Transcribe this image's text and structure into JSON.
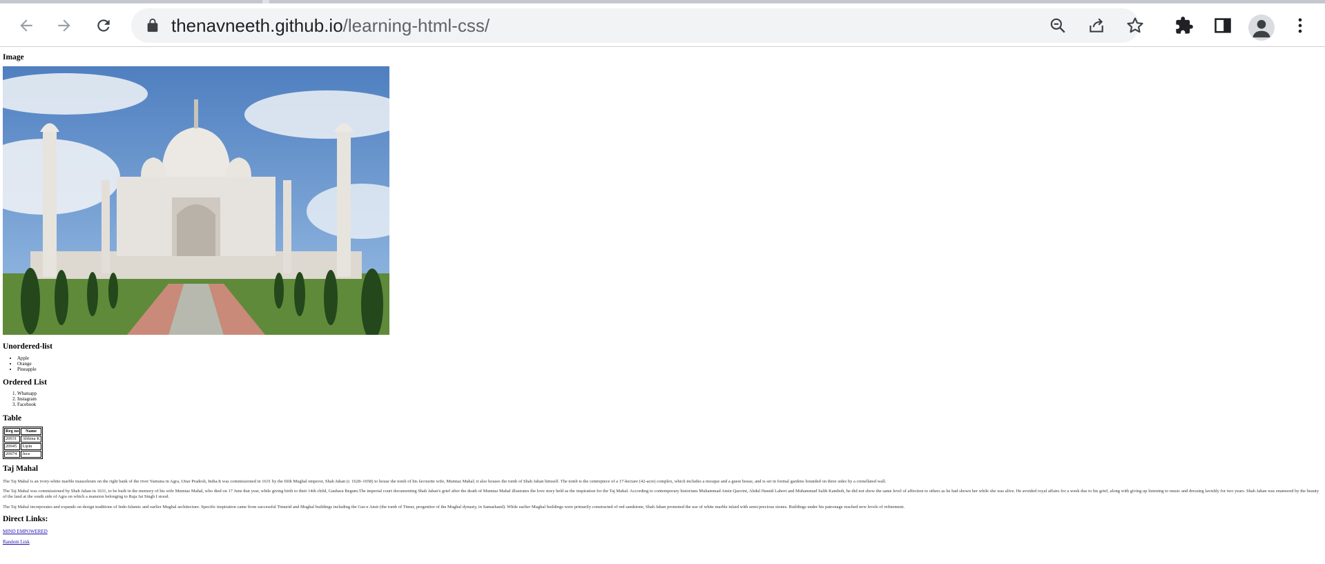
{
  "browser": {
    "url_host": "thenavneeth.github.io",
    "url_path": "/learning-html-css/",
    "icons": [
      "back-icon",
      "forward-icon",
      "reload-icon",
      "lock-icon",
      "zoom-out-icon",
      "share-icon",
      "star-icon",
      "extensions-icon",
      "side-panel-icon",
      "profile-icon",
      "menu-icon"
    ]
  },
  "page": {
    "image_heading": "Image",
    "unordered_heading": "Unordered-list",
    "unordered_items": [
      "Apple",
      "Orange",
      "Pineapple"
    ],
    "ordered_heading": "Ordered List",
    "ordered_items": [
      "Whatsapp",
      "Instagram",
      "Facebook"
    ],
    "table_heading": "Table",
    "table": {
      "headers": [
        "Reg no",
        "Name"
      ],
      "rows": [
        [
          "20031",
          "Abhina K"
        ],
        [
          "20045",
          "Lipin"
        ],
        [
          "20074",
          "Jece"
        ]
      ]
    },
    "taj_heading": "Taj Mahal",
    "paragraphs": [
      "The Taj Mahal is an ivory-white marble mausoleum on the right bank of the river Yamuna in Agra, Uttar Pradesh, India.It was commissioned in 1631 by the fifth Mughal emperor, Shah Jahan (r. 1628–1658) to house the tomb of his favourite wife, Mumtaz Mahal; it also houses the tomb of Shah Jahan himself. The tomb is the centrepiece of a 17-hectare (42-acre) complex, which includes a mosque and a guest house, and is set in formal gardens bounded on three sides by a crenellated wall.",
      "The Taj Mahal was commissioned by Shah Jahan in 1631, to be built in the memory of his wife Mumtaz Mahal, who died on 17 June that year, while giving birth to their 14th child, Gauhara Begum.The imperial court documenting Shah Jahan's grief after the death of Mumtaz Mahal illustrates the love story held as the inspiration for the Taj Mahal. According to contemporary historians Muhammad Amin Qazvini, Abdul Hamid Lahori and Muhammad Salih Kamboh, he did not show the same level of affection to others as he had shown her while she was alive. He avoided royal affairs for a week due to his grief, along with giving up listening to music and dressing lavishly for two years. Shah Jahan was enamored by the beauty of the land at the south side of Agra on which a mansion belonging to Raja Jai Singh I stood.",
      "The Taj Mahal incorporates and expands on design traditions of Indo-Islamic and earlier Mughal architecture. Specific inspiration came from successful Timurid and Mughal buildings including the Gur-e Amir (the tomb of Timur, progenitor of the Mughal dynasty, in Samarkand). While earlier Mughal buildings were primarily constructed of red sandstone, Shah Jahan promoted the use of white marble inlaid with semi-precious stones. Buildings under his patronage reached new levels of refinement."
    ],
    "direct_heading": "Direct Links:",
    "links": [
      "MIND EMPOWERED",
      "Random Link"
    ]
  }
}
